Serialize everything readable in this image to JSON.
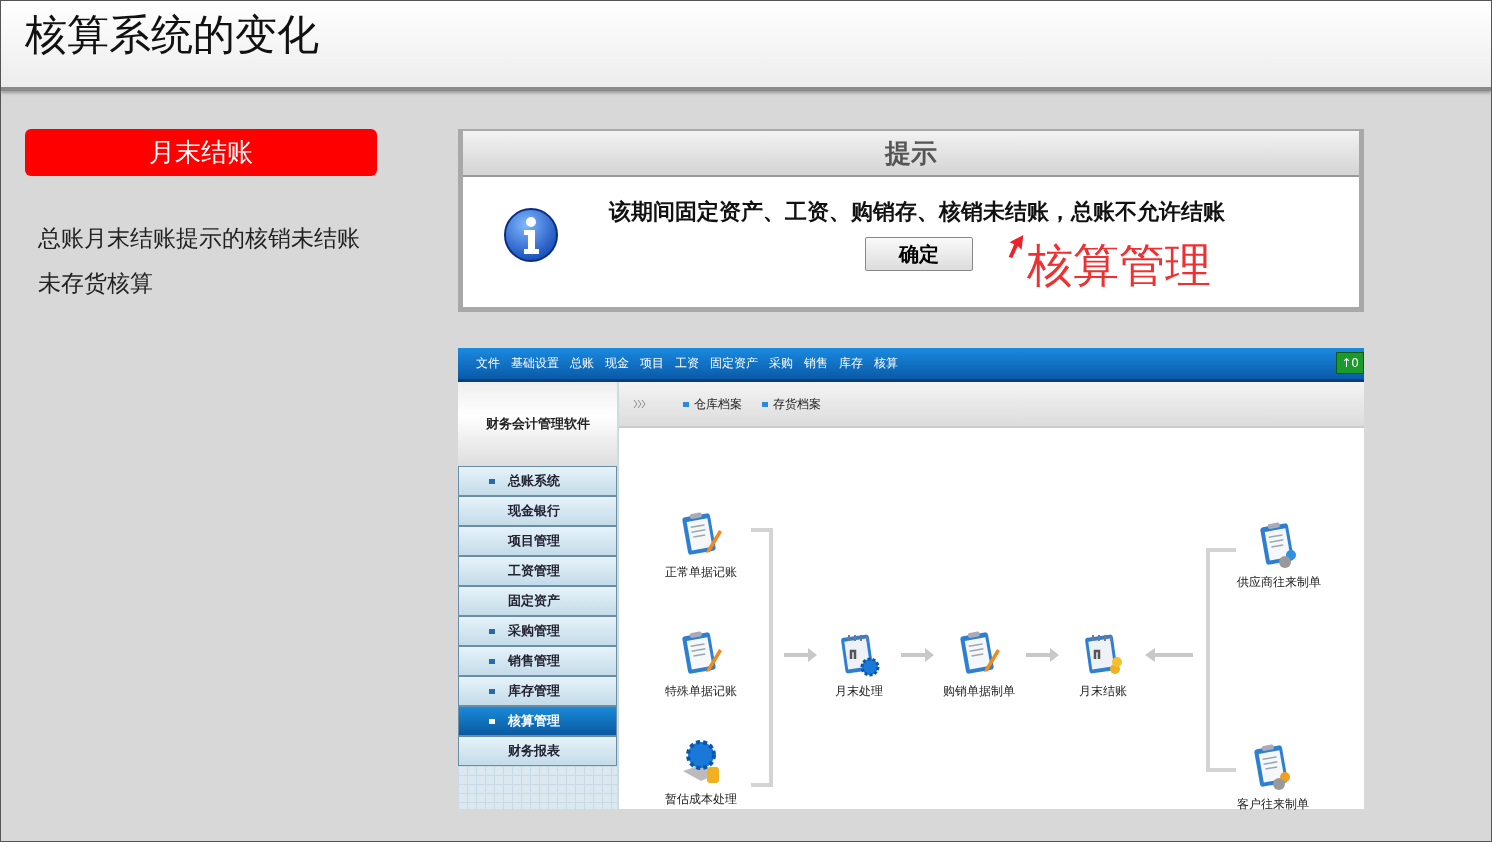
{
  "slide": {
    "title": "核算系统的变化"
  },
  "section_button": {
    "label": "月末结账"
  },
  "description": "总账月末结账提示的核销未结账未存货核算",
  "dialog": {
    "title": "提示",
    "message": "该期间固定资产、工资、购销存、核销未结账，总账不允许结账",
    "ok_button": "确定",
    "annotation": "核算管理"
  },
  "software": {
    "menu": [
      "文件",
      "基础设置",
      "总账",
      "现金",
      "项目",
      "工资",
      "固定资产",
      "采购",
      "销售",
      "库存",
      "核算"
    ],
    "status_badge": "↑0",
    "app_title": "财务会计管理软件",
    "tabs": [
      "仓库档案",
      "存货档案"
    ],
    "sidebar": [
      {
        "label": "总账系统",
        "expandable": true,
        "selected": false
      },
      {
        "label": "现金银行",
        "expandable": false,
        "selected": false
      },
      {
        "label": "项目管理",
        "expandable": false,
        "selected": false
      },
      {
        "label": "工资管理",
        "expandable": false,
        "selected": false
      },
      {
        "label": "固定资产",
        "expandable": false,
        "selected": false
      },
      {
        "label": "采购管理",
        "expandable": true,
        "selected": false
      },
      {
        "label": "销售管理",
        "expandable": true,
        "selected": false
      },
      {
        "label": "库存管理",
        "expandable": true,
        "selected": false
      },
      {
        "label": "核算管理",
        "expandable": true,
        "selected": true
      },
      {
        "label": "财务报表",
        "expandable": false,
        "selected": false
      }
    ],
    "flow": [
      {
        "label": "正常单据记账",
        "kind": "clipboard"
      },
      {
        "label": "特殊单据记账",
        "kind": "clipboard"
      },
      {
        "label": "暂估成本处理",
        "kind": "gear"
      },
      {
        "label": "月末处理",
        "kind": "calendar-gear"
      },
      {
        "label": "购销单据制单",
        "kind": "clipboard"
      },
      {
        "label": "月末结账",
        "kind": "calendar-coins"
      },
      {
        "label": "供应商往来制单",
        "kind": "clipboard-person"
      },
      {
        "label": "客户往来制单",
        "kind": "clipboard-person"
      }
    ]
  }
}
